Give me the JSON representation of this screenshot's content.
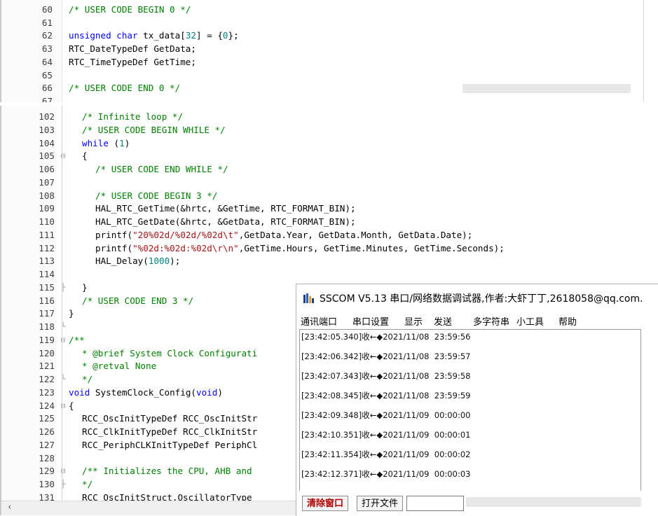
{
  "editor_top": {
    "lines": [
      {
        "num": "60",
        "fold": "",
        "parts": [
          {
            "t": "/* USER CODE BEGIN 0 */",
            "c": "c"
          }
        ]
      },
      {
        "num": "61",
        "fold": "",
        "parts": []
      },
      {
        "num": "62",
        "fold": "",
        "parts": [
          {
            "t": "unsigned char",
            "c": "k"
          },
          {
            "t": " tx_data[",
            "c": ""
          },
          {
            "t": "32",
            "c": "n"
          },
          {
            "t": "] = {",
            "c": ""
          },
          {
            "t": "0",
            "c": "n"
          },
          {
            "t": "};",
            "c": ""
          }
        ]
      },
      {
        "num": "63",
        "fold": "",
        "parts": [
          {
            "t": "RTC_DateTypeDef GetData;",
            "c": ""
          }
        ]
      },
      {
        "num": "64",
        "fold": "",
        "parts": [
          {
            "t": "RTC_TimeTypeDef GetTime;",
            "c": ""
          }
        ]
      },
      {
        "num": "65",
        "fold": "",
        "parts": []
      },
      {
        "num": "66",
        "fold": "",
        "parts": [
          {
            "t": "/* USER CODE END 0 */",
            "c": "c"
          }
        ]
      },
      {
        "num": "67",
        "fold": "",
        "parts": []
      }
    ]
  },
  "editor_main": {
    "lines": [
      {
        "num": "102",
        "fold": "",
        "indent": 1,
        "parts": [
          {
            "t": "/* Infinite loop */",
            "c": "c"
          }
        ]
      },
      {
        "num": "103",
        "fold": "",
        "indent": 1,
        "parts": [
          {
            "t": "/* USER CODE BEGIN WHILE */",
            "c": "c"
          }
        ]
      },
      {
        "num": "104",
        "fold": "",
        "indent": 1,
        "parts": [
          {
            "t": "while",
            "c": "k"
          },
          {
            "t": " (",
            "c": ""
          },
          {
            "t": "1",
            "c": "n"
          },
          {
            "t": ")",
            "c": ""
          }
        ]
      },
      {
        "num": "105",
        "fold": "⊟",
        "indent": 1,
        "parts": [
          {
            "t": "{",
            "c": ""
          }
        ]
      },
      {
        "num": "106",
        "fold": "",
        "indent": 2,
        "parts": [
          {
            "t": "/* USER CODE END WHILE */",
            "c": "c"
          }
        ]
      },
      {
        "num": "107",
        "fold": "",
        "indent": 2,
        "parts": []
      },
      {
        "num": "108",
        "fold": "",
        "indent": 2,
        "parts": [
          {
            "t": "/* USER CODE BEGIN 3 */",
            "c": "c"
          }
        ]
      },
      {
        "num": "109",
        "fold": "",
        "indent": 2,
        "parts": [
          {
            "t": "HAL_RTC_GetTime(&hrtc, &GetTime, RTC_FORMAT_BIN);",
            "c": ""
          }
        ]
      },
      {
        "num": "110",
        "fold": "",
        "indent": 2,
        "parts": [
          {
            "t": "HAL_RTC_GetDate(&hrtc, &GetData, RTC_FORMAT_BIN);",
            "c": ""
          }
        ]
      },
      {
        "num": "111",
        "fold": "",
        "indent": 2,
        "parts": [
          {
            "t": "printf(",
            "c": ""
          },
          {
            "t": "\"20%02d/%02d/%02d\\t\"",
            "c": "s"
          },
          {
            "t": ",GetData.Year, GetData.Month, GetData.Date);",
            "c": ""
          }
        ]
      },
      {
        "num": "112",
        "fold": "",
        "indent": 2,
        "parts": [
          {
            "t": "printf(",
            "c": ""
          },
          {
            "t": "\"%02d:%02d:%02d\\r\\n\"",
            "c": "s"
          },
          {
            "t": ",GetTime.Hours, GetTime.Minutes, GetTime.Seconds);",
            "c": ""
          }
        ]
      },
      {
        "num": "113",
        "fold": "",
        "indent": 2,
        "parts": [
          {
            "t": "HAL_Delay(",
            "c": ""
          },
          {
            "t": "1000",
            "c": "n"
          },
          {
            "t": ");",
            "c": ""
          }
        ]
      },
      {
        "num": "114",
        "fold": "",
        "indent": 2,
        "parts": []
      },
      {
        "num": "115",
        "fold": "├",
        "indent": 1,
        "parts": [
          {
            "t": "}",
            "c": ""
          }
        ]
      },
      {
        "num": "116",
        "fold": "",
        "indent": 1,
        "parts": [
          {
            "t": "/* USER CODE END 3 */",
            "c": "c"
          }
        ]
      },
      {
        "num": "117",
        "fold": "",
        "indent": 0,
        "parts": [
          {
            "t": "}",
            "c": ""
          }
        ]
      },
      {
        "num": "118",
        "fold": "└",
        "indent": 0,
        "parts": []
      },
      {
        "num": "119",
        "fold": "⊟",
        "indent": 0,
        "parts": [
          {
            "t": "/**",
            "c": "c"
          }
        ]
      },
      {
        "num": "120",
        "fold": "",
        "indent": 1,
        "parts": [
          {
            "t": "* @brief System Clock Configurati",
            "c": "c"
          }
        ]
      },
      {
        "num": "121",
        "fold": "",
        "indent": 1,
        "parts": [
          {
            "t": "* @retval None",
            "c": "c"
          }
        ]
      },
      {
        "num": "122",
        "fold": "└",
        "indent": 1,
        "parts": [
          {
            "t": "*/",
            "c": "c"
          }
        ]
      },
      {
        "num": "123",
        "fold": "",
        "indent": 0,
        "parts": [
          {
            "t": "void",
            "c": "k"
          },
          {
            "t": " SystemClock_Config(",
            "c": ""
          },
          {
            "t": "void",
            "c": "k"
          },
          {
            "t": ")",
            "c": ""
          }
        ]
      },
      {
        "num": "124",
        "fold": "⊟",
        "indent": 0,
        "parts": [
          {
            "t": "{",
            "c": ""
          }
        ]
      },
      {
        "num": "125",
        "fold": "",
        "indent": 1,
        "parts": [
          {
            "t": "RCC_OscInitTypeDef RCC_OscInitStr",
            "c": ""
          }
        ]
      },
      {
        "num": "126",
        "fold": "",
        "indent": 1,
        "parts": [
          {
            "t": "RCC_ClkInitTypeDef RCC_ClkInitStr",
            "c": ""
          }
        ]
      },
      {
        "num": "127",
        "fold": "",
        "indent": 1,
        "parts": [
          {
            "t": "RCC_PeriphCLKInitTypeDef PeriphCl",
            "c": ""
          }
        ]
      },
      {
        "num": "128",
        "fold": "",
        "indent": 1,
        "parts": []
      },
      {
        "num": "129",
        "fold": "⊟",
        "indent": 1,
        "parts": [
          {
            "t": "/** Initializes the CPU, AHB and",
            "c": "c"
          }
        ]
      },
      {
        "num": "130",
        "fold": "├",
        "indent": 1,
        "parts": [
          {
            "t": "*/",
            "c": "c"
          }
        ]
      },
      {
        "num": "131",
        "fold": "",
        "indent": 1,
        "parts": [
          {
            "t": "RCC_OscInitStruct.OscillatorType",
            "c": ""
          }
        ]
      }
    ]
  },
  "sscom": {
    "title": "SSCOM V5.13 串口/网络数据调试器,作者:大虾丁丁,2618058@qq.com.",
    "menu": [
      "通讯端口",
      "串口设置",
      "显示",
      "发送",
      "多字符串",
      "小工具",
      "帮助"
    ],
    "receive_lines": [
      "[23:42:05.340]收←◆2021/11/08  23:59:56",
      "[23:42:06.342]收←◆2021/11/08  23:59:57",
      "[23:42:07.343]收←◆2021/11/08  23:59:58",
      "[23:42:08.345]收←◆2021/11/08  23:59:59",
      "[23:42:09.348]收←◆2021/11/09  00:00:00",
      "[23:42:10.351]收←◆2021/11/09  00:00:01",
      "[23:42:11.354]收←◆2021/11/09  00:00:02",
      "[23:42:12.371]收←◆2021/11/09  00:00:03"
    ],
    "clear_button": "清除窗口",
    "open_file_button": "打开文件"
  },
  "scrollbar": {
    "left_arrow": "‹"
  }
}
